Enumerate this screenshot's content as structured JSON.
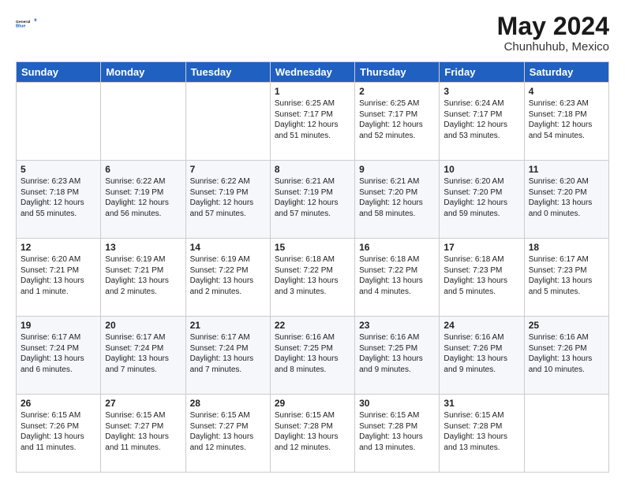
{
  "header": {
    "logo_line1": "General",
    "logo_line2": "Blue",
    "month": "May 2024",
    "location": "Chunhuhub, Mexico"
  },
  "weekdays": [
    "Sunday",
    "Monday",
    "Tuesday",
    "Wednesday",
    "Thursday",
    "Friday",
    "Saturday"
  ],
  "weeks": [
    [
      {
        "day": "",
        "sunrise": "",
        "sunset": "",
        "daylight": ""
      },
      {
        "day": "",
        "sunrise": "",
        "sunset": "",
        "daylight": ""
      },
      {
        "day": "",
        "sunrise": "",
        "sunset": "",
        "daylight": ""
      },
      {
        "day": "1",
        "sunrise": "Sunrise: 6:25 AM",
        "sunset": "Sunset: 7:17 PM",
        "daylight": "Daylight: 12 hours and 51 minutes."
      },
      {
        "day": "2",
        "sunrise": "Sunrise: 6:25 AM",
        "sunset": "Sunset: 7:17 PM",
        "daylight": "Daylight: 12 hours and 52 minutes."
      },
      {
        "day": "3",
        "sunrise": "Sunrise: 6:24 AM",
        "sunset": "Sunset: 7:17 PM",
        "daylight": "Daylight: 12 hours and 53 minutes."
      },
      {
        "day": "4",
        "sunrise": "Sunrise: 6:23 AM",
        "sunset": "Sunset: 7:18 PM",
        "daylight": "Daylight: 12 hours and 54 minutes."
      }
    ],
    [
      {
        "day": "5",
        "sunrise": "Sunrise: 6:23 AM",
        "sunset": "Sunset: 7:18 PM",
        "daylight": "Daylight: 12 hours and 55 minutes."
      },
      {
        "day": "6",
        "sunrise": "Sunrise: 6:22 AM",
        "sunset": "Sunset: 7:19 PM",
        "daylight": "Daylight: 12 hours and 56 minutes."
      },
      {
        "day": "7",
        "sunrise": "Sunrise: 6:22 AM",
        "sunset": "Sunset: 7:19 PM",
        "daylight": "Daylight: 12 hours and 57 minutes."
      },
      {
        "day": "8",
        "sunrise": "Sunrise: 6:21 AM",
        "sunset": "Sunset: 7:19 PM",
        "daylight": "Daylight: 12 hours and 57 minutes."
      },
      {
        "day": "9",
        "sunrise": "Sunrise: 6:21 AM",
        "sunset": "Sunset: 7:20 PM",
        "daylight": "Daylight: 12 hours and 58 minutes."
      },
      {
        "day": "10",
        "sunrise": "Sunrise: 6:20 AM",
        "sunset": "Sunset: 7:20 PM",
        "daylight": "Daylight: 12 hours and 59 minutes."
      },
      {
        "day": "11",
        "sunrise": "Sunrise: 6:20 AM",
        "sunset": "Sunset: 7:20 PM",
        "daylight": "Daylight: 13 hours and 0 minutes."
      }
    ],
    [
      {
        "day": "12",
        "sunrise": "Sunrise: 6:20 AM",
        "sunset": "Sunset: 7:21 PM",
        "daylight": "Daylight: 13 hours and 1 minute."
      },
      {
        "day": "13",
        "sunrise": "Sunrise: 6:19 AM",
        "sunset": "Sunset: 7:21 PM",
        "daylight": "Daylight: 13 hours and 2 minutes."
      },
      {
        "day": "14",
        "sunrise": "Sunrise: 6:19 AM",
        "sunset": "Sunset: 7:22 PM",
        "daylight": "Daylight: 13 hours and 2 minutes."
      },
      {
        "day": "15",
        "sunrise": "Sunrise: 6:18 AM",
        "sunset": "Sunset: 7:22 PM",
        "daylight": "Daylight: 13 hours and 3 minutes."
      },
      {
        "day": "16",
        "sunrise": "Sunrise: 6:18 AM",
        "sunset": "Sunset: 7:22 PM",
        "daylight": "Daylight: 13 hours and 4 minutes."
      },
      {
        "day": "17",
        "sunrise": "Sunrise: 6:18 AM",
        "sunset": "Sunset: 7:23 PM",
        "daylight": "Daylight: 13 hours and 5 minutes."
      },
      {
        "day": "18",
        "sunrise": "Sunrise: 6:17 AM",
        "sunset": "Sunset: 7:23 PM",
        "daylight": "Daylight: 13 hours and 5 minutes."
      }
    ],
    [
      {
        "day": "19",
        "sunrise": "Sunrise: 6:17 AM",
        "sunset": "Sunset: 7:24 PM",
        "daylight": "Daylight: 13 hours and 6 minutes."
      },
      {
        "day": "20",
        "sunrise": "Sunrise: 6:17 AM",
        "sunset": "Sunset: 7:24 PM",
        "daylight": "Daylight: 13 hours and 7 minutes."
      },
      {
        "day": "21",
        "sunrise": "Sunrise: 6:17 AM",
        "sunset": "Sunset: 7:24 PM",
        "daylight": "Daylight: 13 hours and 7 minutes."
      },
      {
        "day": "22",
        "sunrise": "Sunrise: 6:16 AM",
        "sunset": "Sunset: 7:25 PM",
        "daylight": "Daylight: 13 hours and 8 minutes."
      },
      {
        "day": "23",
        "sunrise": "Sunrise: 6:16 AM",
        "sunset": "Sunset: 7:25 PM",
        "daylight": "Daylight: 13 hours and 9 minutes."
      },
      {
        "day": "24",
        "sunrise": "Sunrise: 6:16 AM",
        "sunset": "Sunset: 7:26 PM",
        "daylight": "Daylight: 13 hours and 9 minutes."
      },
      {
        "day": "25",
        "sunrise": "Sunrise: 6:16 AM",
        "sunset": "Sunset: 7:26 PM",
        "daylight": "Daylight: 13 hours and 10 minutes."
      }
    ],
    [
      {
        "day": "26",
        "sunrise": "Sunrise: 6:15 AM",
        "sunset": "Sunset: 7:26 PM",
        "daylight": "Daylight: 13 hours and 11 minutes."
      },
      {
        "day": "27",
        "sunrise": "Sunrise: 6:15 AM",
        "sunset": "Sunset: 7:27 PM",
        "daylight": "Daylight: 13 hours and 11 minutes."
      },
      {
        "day": "28",
        "sunrise": "Sunrise: 6:15 AM",
        "sunset": "Sunset: 7:27 PM",
        "daylight": "Daylight: 13 hours and 12 minutes."
      },
      {
        "day": "29",
        "sunrise": "Sunrise: 6:15 AM",
        "sunset": "Sunset: 7:28 PM",
        "daylight": "Daylight: 13 hours and 12 minutes."
      },
      {
        "day": "30",
        "sunrise": "Sunrise: 6:15 AM",
        "sunset": "Sunset: 7:28 PM",
        "daylight": "Daylight: 13 hours and 13 minutes."
      },
      {
        "day": "31",
        "sunrise": "Sunrise: 6:15 AM",
        "sunset": "Sunset: 7:28 PM",
        "daylight": "Daylight: 13 hours and 13 minutes."
      },
      {
        "day": "",
        "sunrise": "",
        "sunset": "",
        "daylight": ""
      }
    ]
  ]
}
